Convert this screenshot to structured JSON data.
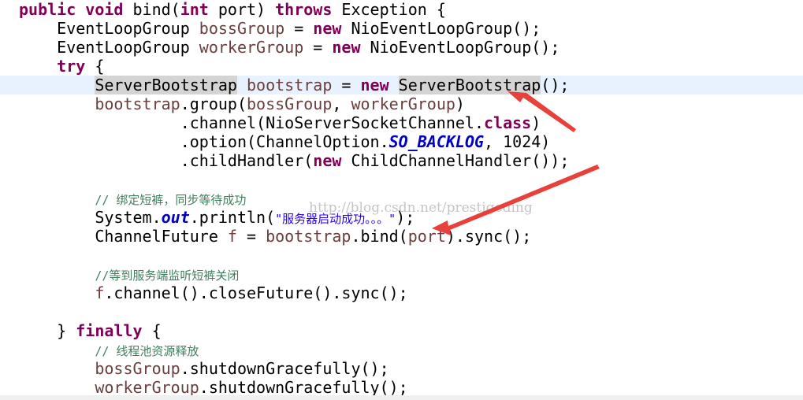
{
  "code": {
    "l1": {
      "kw1": "public",
      "kw2": "void",
      "t1": " bind(",
      "kw3": "int",
      "t2": " port) ",
      "kw4": "throws",
      "t3": " Exception {"
    },
    "l2": {
      "t1": "EventLoopGroup ",
      "v": "bossGroup",
      "t2": " = ",
      "kw": "new",
      "t3": " NioEventLoopGroup();"
    },
    "l3": {
      "t1": "EventLoopGroup ",
      "v": "workerGroup",
      "t2": " = ",
      "kw": "new",
      "t3": " NioEventLoopGroup();"
    },
    "l4": {
      "kw": "try",
      "t": " {"
    },
    "l5": {
      "h1": "ServerBootstrap",
      "sp": " ",
      "v": "bootstrap",
      "t1": " = ",
      "kw": "new",
      "t2": " ",
      "h2": "ServerBootstrap",
      "t3": "();"
    },
    "l6": {
      "v1": "bootstrap",
      "t1": ".group(",
      "v2": "bossGroup",
      "t2": ", ",
      "v3": "workerGroup",
      "t3": ")"
    },
    "l7": {
      "t1": ".channel(NioServerSocketChannel.",
      "kw": "class",
      "t2": ")"
    },
    "l8": {
      "t1": ".option(ChannelOption.",
      "f": "SO_BACKLOG",
      "t2": ", 1024)"
    },
    "l9": {
      "t1": ".childHandler(",
      "kw": "new",
      "t2": " ChildChannelHandler());"
    },
    "l10": {
      "cm": "// 绑定短裤，同步等待成功"
    },
    "l11": {
      "t1": "System.",
      "f": "out",
      "t2": ".println(",
      "s": "\"服务器启动成功。。。\"",
      "t3": ");"
    },
    "l12": {
      "t1": "ChannelFuture ",
      "v1": "f",
      "t2": " = ",
      "v2": "bootstrap",
      "t3": ".bind(",
      "v3": "port",
      "t4": ").sync();"
    },
    "l13": {
      "cm": "//等到服务端监听短裤关闭"
    },
    "l14": {
      "v": "f",
      "t": ".channel().closeFuture().sync();"
    },
    "l15": {
      "t1": "} ",
      "kw": "finally",
      "t2": " {"
    },
    "l16": {
      "cm": "// 线程池资源释放"
    },
    "l17": {
      "v": "bossGroup",
      "t": ".shutdownGracefully();"
    },
    "l18": {
      "v": "workerGroup",
      "t": ".shutdownGracefully();"
    }
  },
  "watermark": "http://blog.csdn.net/prestigeding",
  "colors": {
    "keyword": "#7f0055",
    "local_variable": "#6a3e3e",
    "static_field": "#0000c0",
    "string": "#2a00ff",
    "comment": "#3f7f5f",
    "current_line": "#e8f2fe",
    "occurrence_highlight": "#d4d4d4",
    "annotation_arrow": "#e8403a"
  }
}
